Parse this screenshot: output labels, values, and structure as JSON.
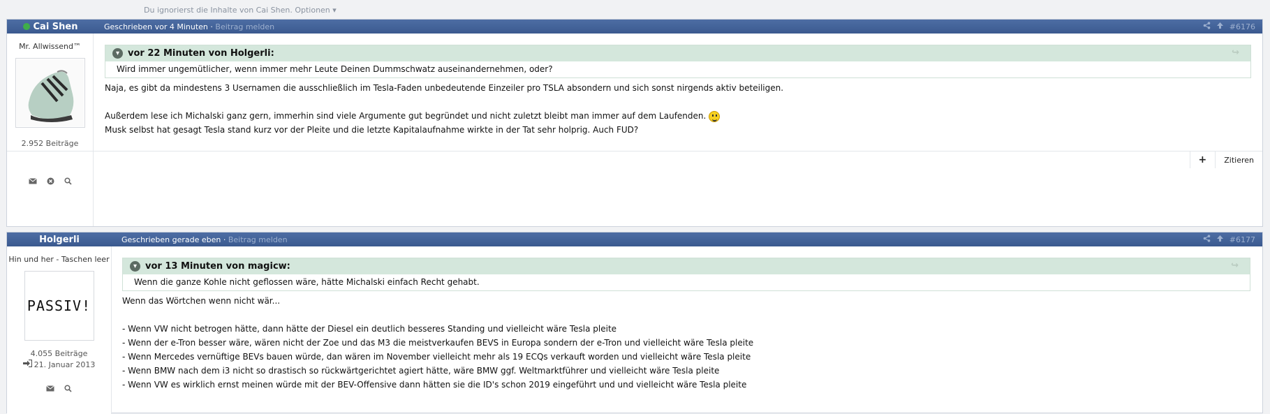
{
  "ignore_bar": {
    "text": "Du ignorierst die Inhalte von Cai Shen.",
    "options_label": "Optionen ▾"
  },
  "posts": [
    {
      "username": "Cai Shen",
      "online": true,
      "user_title": "Mr. Allwissend™",
      "posts_count": "2.952 Beiträge",
      "written": "Geschrieben vor 4 Minuten",
      "report": "Beitrag melden",
      "post_number": "#6176",
      "quote": {
        "header": "vor 22 Minuten von Holgerli:",
        "text": "Wird immer ungemütlicher, wenn immer mehr Leute Deinen Dummschwatz auseinandernehmen, oder?"
      },
      "body": [
        "Naja, es gibt da mindestens 3 Usernamen die ausschließlich im Tesla-Faden unbedeutende Einzeiler pro TSLA absondern und sich sonst nirgends aktiv beteiligen.",
        "",
        "Außerdem lese ich Michalski ganz gern, immerhin sind viele Argumente gut begründet und nicht zuletzt bleibt man immer auf dem Laufenden.",
        "Musk selbst hat gesagt Tesla stand kurz vor der Pleite und die letzte Kapitalaufnahme wirkte in der Tat sehr holprig. Auch FUD?"
      ],
      "quote_button": "Zitieren",
      "plus_button": "+"
    },
    {
      "username": "Holgerli",
      "online": false,
      "user_title": "Hin und her - Taschen leer",
      "avatar_text": "PASSIV!",
      "posts_count": "4.055 Beiträge",
      "joined": "21. Januar 2013",
      "written": "Geschrieben gerade eben",
      "report": "Beitrag melden",
      "post_number": "#6177",
      "quote": {
        "header": "vor 13 Minuten von magicw:",
        "text": "Wenn die ganze Kohle nicht geflossen wäre, hätte Michalski einfach Recht gehabt."
      },
      "body": [
        "Wenn das Wörtchen wenn nicht wär...",
        "",
        "- Wenn VW nicht betrogen hätte, dann hätte der Diesel ein deutlich besseres Standing und vielleicht wäre Tesla pleite",
        "- Wenn der e-Tron besser wäre, wären nicht der Zoe und das M3 die meistverkaufen BEVS in Europa sondern der e-Tron und vielleicht wäre Tesla pleite",
        "- Wenn Mercedes vernüftige BEVs bauen würde, dan wären im November vielleicht mehr als 19 ECQs verkauft worden und vielleicht wäre Tesla pleite",
        "- Wenn BMW nach dem i3 nicht so drastisch so rückwärtgerichtet agiert hätte, wäre BMW ggf. Weltmarktführer und vielleicht wäre Tesla pleite",
        "- Wenn VW es wirklich ernst meinen würde mit der BEV-Offensive dann hätten sie die ID's schon 2019 eingeführt und und vielleicht wäre Tesla pleite"
      ]
    }
  ],
  "colors": {
    "header_bg": "#3b5a8f",
    "quote_head_bg": "#d4e7dc",
    "online": "#3fae4a"
  },
  "icons": [
    "envelope-icon",
    "ignore-icon",
    "search-icon",
    "share-icon",
    "upvote-icon",
    "quote-reply-icon",
    "login-icon",
    "chevron-down-icon"
  ]
}
